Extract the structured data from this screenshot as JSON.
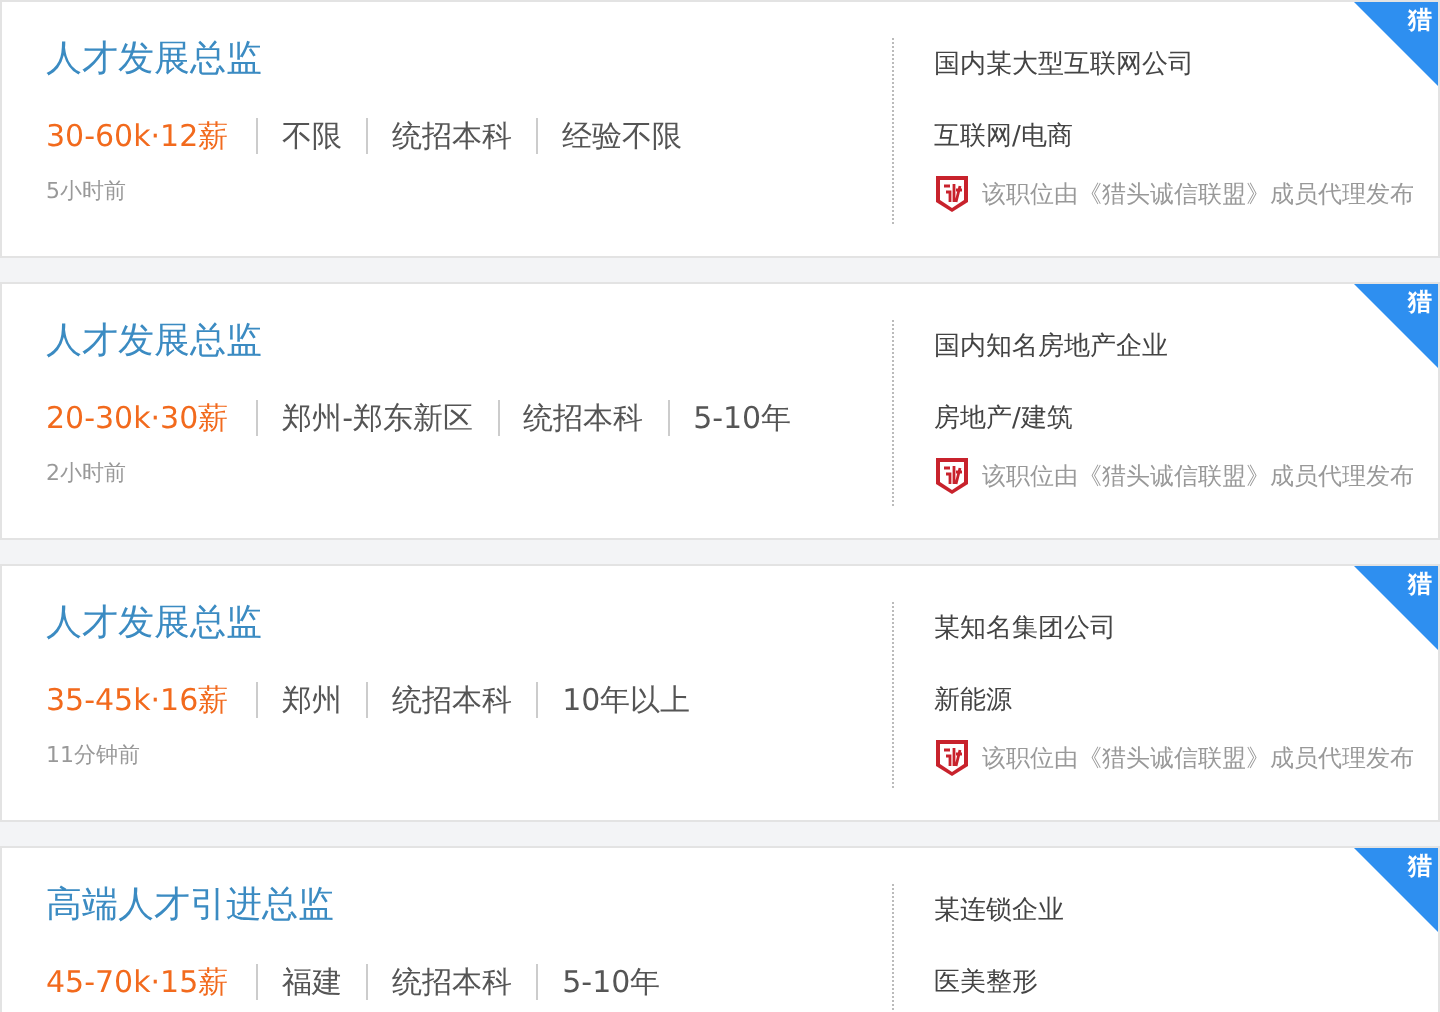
{
  "jobs": [
    {
      "title": "人才发展总监",
      "salary": "30-60k·12薪",
      "tags": [
        "不限",
        "统招本科",
        "经验不限"
      ],
      "time": "5小时前",
      "company": "国内某大型互联网公司",
      "industry": "互联网/电商",
      "notice": "该职位由《猎头诚信联盟》成员代理发布",
      "corner": "猎"
    },
    {
      "title": "人才发展总监",
      "salary": "20-30k·30薪",
      "tags": [
        "郑州-郑东新区",
        "统招本科",
        "5-10年"
      ],
      "time": "2小时前",
      "company": "国内知名房地产企业",
      "industry": "房地产/建筑",
      "notice": "该职位由《猎头诚信联盟》成员代理发布",
      "corner": "猎"
    },
    {
      "title": "人才发展总监",
      "salary": "35-45k·16薪",
      "tags": [
        "郑州",
        "统招本科",
        "10年以上"
      ],
      "time": "11分钟前",
      "company": "某知名集团公司",
      "industry": "新能源",
      "notice": "该职位由《猎头诚信联盟》成员代理发布",
      "corner": "猎"
    },
    {
      "title": "高端人才引进总监",
      "salary": "45-70k·15薪",
      "tags": [
        "福建",
        "统招本科",
        "5-10年"
      ],
      "company": "某连锁企业",
      "industry": "医美整形",
      "corner": "猎"
    }
  ]
}
